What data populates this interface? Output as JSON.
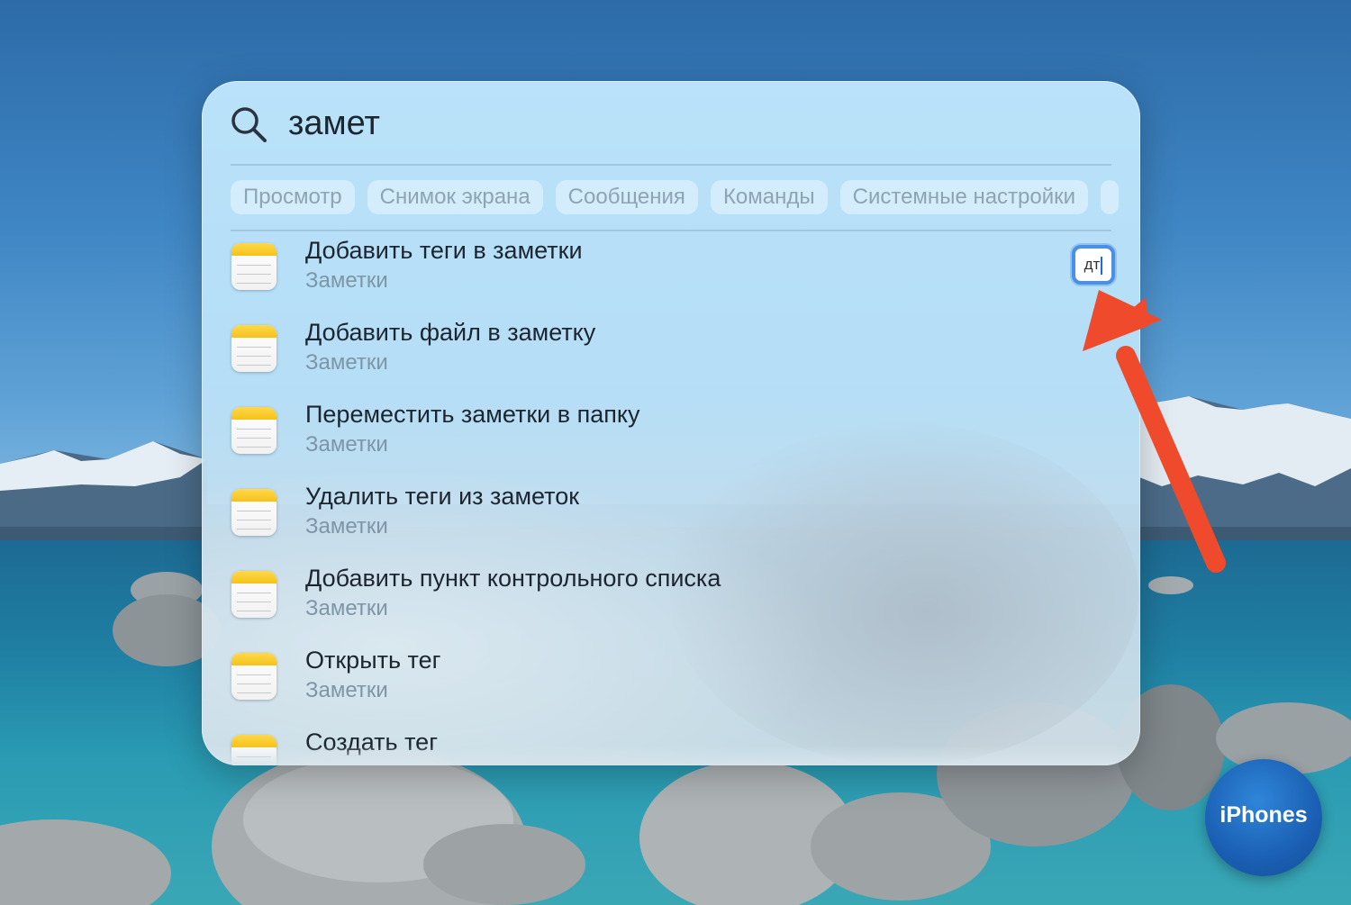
{
  "search": {
    "query": "замет"
  },
  "filter_chips": [
    "Просмотр",
    "Снимок экрана",
    "Сообщения",
    "Команды",
    "Системные настройки"
  ],
  "results": [
    {
      "title": "Добавить теги в заметки",
      "subtitle": "Заметки"
    },
    {
      "title": "Добавить файл в заметку",
      "subtitle": "Заметки"
    },
    {
      "title": "Переместить заметки в папку",
      "subtitle": "Заметки"
    },
    {
      "title": "Удалить теги из заметок",
      "subtitle": "Заметки"
    },
    {
      "title": "Добавить пункт контрольного списка",
      "subtitle": "Заметки"
    },
    {
      "title": "Открыть тег",
      "subtitle": "Заметки"
    },
    {
      "title": "Создать тег",
      "subtitle": ""
    }
  ],
  "shortcut_badge": {
    "text": "дт"
  },
  "watermark": {
    "text": "iPhones"
  },
  "colors": {
    "arrow": "#f04a2c",
    "badge_border": "#4c8fe6",
    "note_icon_top": "#f5c21a",
    "watermark": "#1a5fb3"
  },
  "icons": {
    "search": "search-icon",
    "result": "notes-app-icon",
    "annotation": "arrow-pointer"
  }
}
